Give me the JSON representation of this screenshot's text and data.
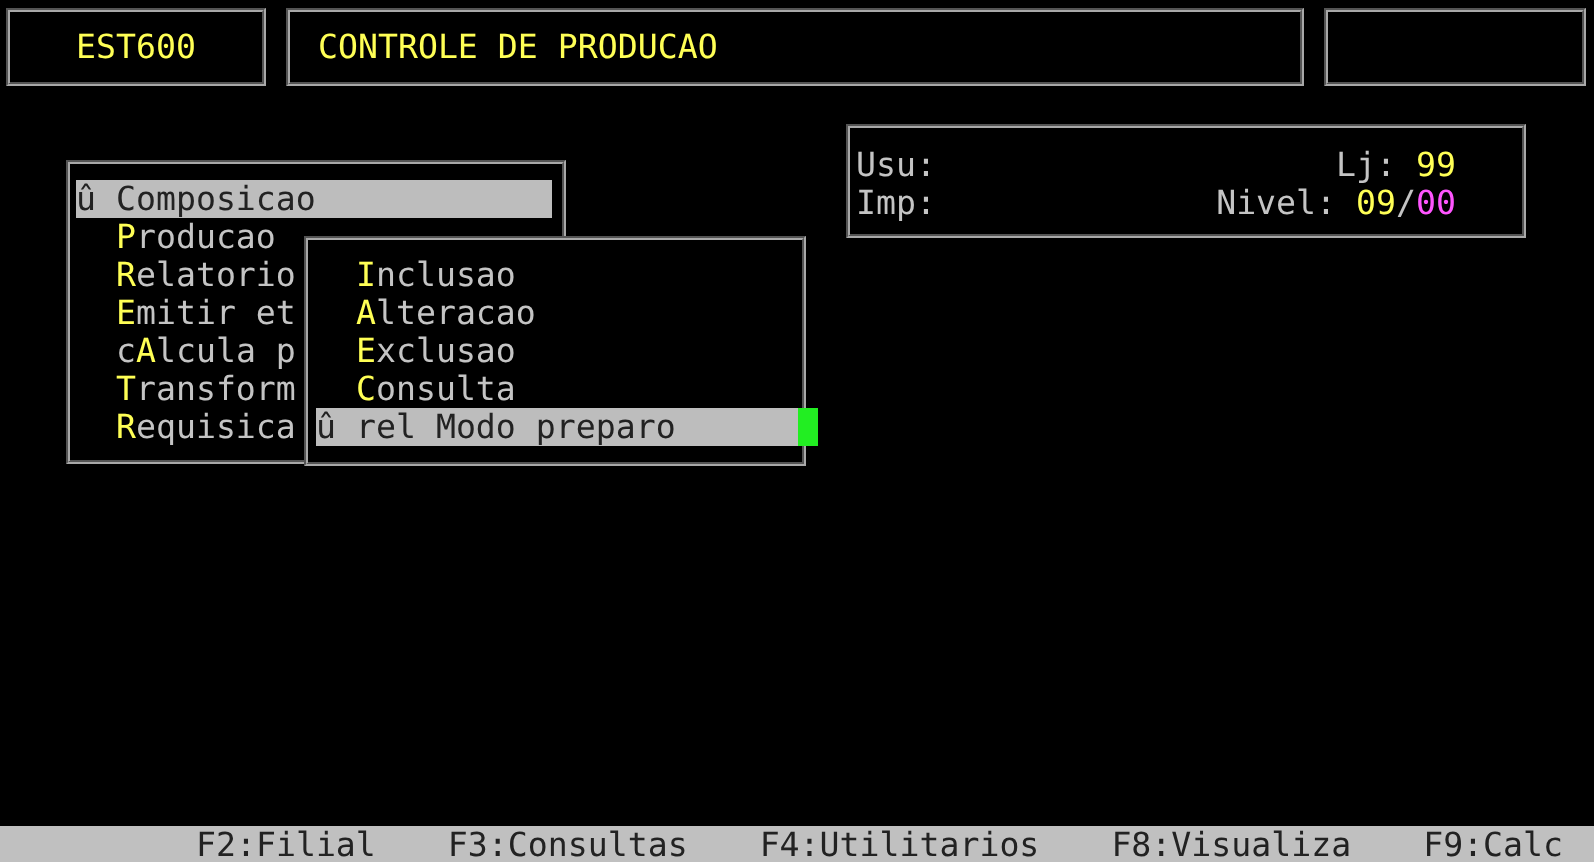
{
  "header": {
    "program_code": "EST600",
    "title": "CONTROLE DE PRODUCAO"
  },
  "menu": {
    "items": [
      {
        "marker": "û",
        "hotkey": "C",
        "after": "omposicao",
        "selected": true
      },
      {
        "hotkey": "P",
        "after": "roducao",
        "selected": false
      },
      {
        "hotkey": "R",
        "after": "elatorio",
        "selected": false
      },
      {
        "hotkey": "E",
        "after": "mitir et",
        "selected": false
      },
      {
        "before": "c",
        "hotkey": "A",
        "after": "lcula p",
        "selected": false
      },
      {
        "hotkey": "T",
        "after": "ransform",
        "selected": false
      },
      {
        "hotkey": "R",
        "after": "equisica",
        "selected": false
      }
    ]
  },
  "submenu": {
    "items": [
      {
        "hotkey": "I",
        "after": "nclusao",
        "selected": false
      },
      {
        "hotkey": "A",
        "after": "lteracao",
        "selected": false
      },
      {
        "hotkey": "E",
        "after": "xclusao",
        "selected": false
      },
      {
        "hotkey": "C",
        "after": "onsulta",
        "selected": false
      },
      {
        "marker": "û",
        "hotkey": "r",
        "after": "el Modo preparo",
        "selected": true
      }
    ]
  },
  "info": {
    "user_label": "Usu:",
    "store_label": "Lj:",
    "store_value": "99",
    "printer_label": "Imp:",
    "nivel_label": "Nivel:",
    "nivel_value": "09",
    "nivel_separator": "/",
    "nivel_max": "00"
  },
  "function_keys": [
    "F2:Filial",
    "F3:Consultas",
    "F4:Utilitarios",
    "F8:Visualiza",
    "F9:Calc"
  ]
}
